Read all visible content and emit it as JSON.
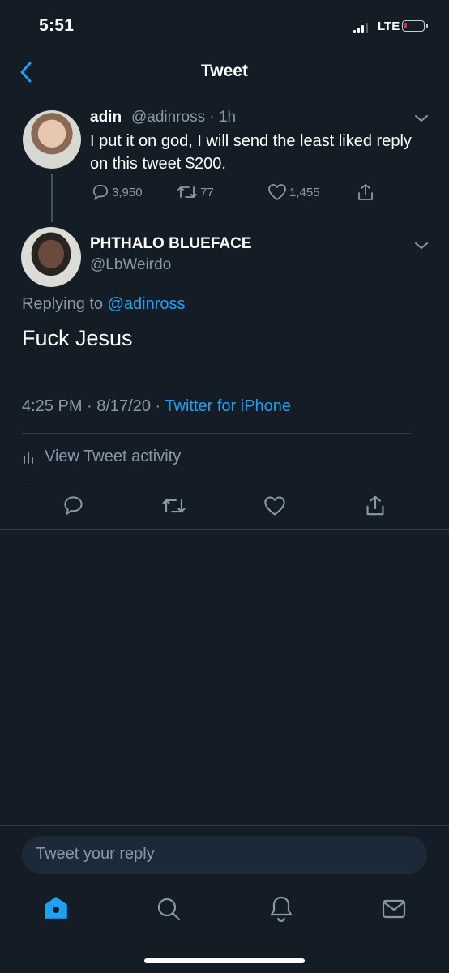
{
  "status_bar": {
    "time": "5:51",
    "network": "LTE"
  },
  "header": {
    "title": "Tweet"
  },
  "parent_tweet": {
    "name": "adin",
    "handle": "@adinross · 1h",
    "text": "I put it on god, I will send the least liked reply on this tweet $200.",
    "replies": "3,950",
    "retweets": "77",
    "likes": "1,455"
  },
  "main_tweet": {
    "name": "PHTHALO BLUEFACE",
    "handle": "@LbWeirdo",
    "replying_prefix": "Replying to ",
    "replying_to": "@adinross",
    "text": "Fuck Jesus",
    "timestamp": "4:25 PM · 8/17/20 · ",
    "source": "Twitter for iPhone",
    "activity_label": "View Tweet activity"
  },
  "composer": {
    "placeholder": "Tweet your reply"
  },
  "tab_bar": {
    "items": [
      "home-icon",
      "search-icon",
      "notifications-icon",
      "messages-icon"
    ]
  },
  "colors": {
    "background": "#141d26",
    "accent": "#1da1f2",
    "secondary_text": "#8899a6",
    "divider": "#2f3b47"
  }
}
